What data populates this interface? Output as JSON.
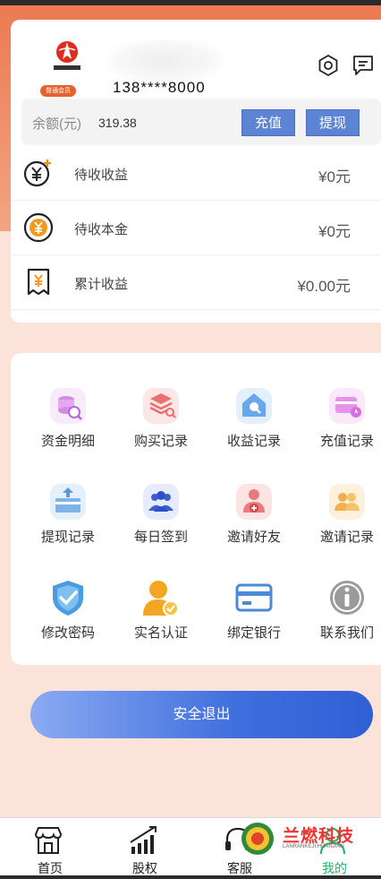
{
  "profile": {
    "vip_badge": "普通会员",
    "phone": "138****8000"
  },
  "balance": {
    "label": "余额(元)",
    "value": "319.38",
    "recharge_label": "充值",
    "withdraw_label": "提现"
  },
  "stats": [
    {
      "label": "待收收益",
      "amount": "¥0元",
      "icon": "yuan-plus-icon"
    },
    {
      "label": "待收本金",
      "amount": "¥0元",
      "icon": "yuan-circle-icon"
    },
    {
      "label": "累计收益",
      "amount": "¥0.00元",
      "icon": "receipt-icon"
    }
  ],
  "menu": [
    {
      "label": "资金明细",
      "icon": "funds-detail-icon"
    },
    {
      "label": "购买记录",
      "icon": "purchase-record-icon"
    },
    {
      "label": "收益记录",
      "icon": "income-record-icon"
    },
    {
      "label": "充值记录",
      "icon": "recharge-record-icon"
    },
    {
      "label": "提现记录",
      "icon": "withdraw-record-icon"
    },
    {
      "label": "每日签到",
      "icon": "daily-checkin-icon"
    },
    {
      "label": "邀请好友",
      "icon": "invite-friend-icon"
    },
    {
      "label": "邀请记录",
      "icon": "invite-record-icon"
    },
    {
      "label": "修改密码",
      "icon": "shield-check-icon"
    },
    {
      "label": "实名认证",
      "icon": "user-verified-icon"
    },
    {
      "label": "绑定银行",
      "icon": "bank-card-icon"
    },
    {
      "label": "联系我们",
      "icon": "info-icon"
    }
  ],
  "logout_label": "安全退出",
  "tabs": [
    {
      "label": "首页",
      "icon": "store-icon"
    },
    {
      "label": "股权",
      "icon": "growth-chart-icon"
    },
    {
      "label": "客服",
      "icon": "headset-icon"
    },
    {
      "label": "我的",
      "icon": "user-icon",
      "active": true
    }
  ],
  "watermark": {
    "text": "兰燃科技",
    "sub": "LANRANKEJI.HUANJIAN"
  },
  "colors": {
    "accent_orange": "#ec7a52",
    "button_blue": "#5d83d4",
    "logout_blue": "#3f6fde",
    "active_tab": "#2db36b"
  }
}
